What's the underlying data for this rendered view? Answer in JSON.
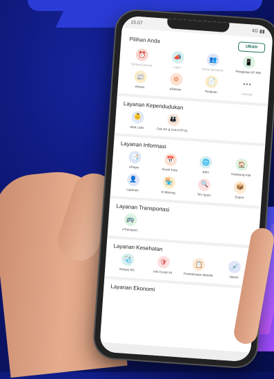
{
  "status": {
    "time": "15.07",
    "right": "4G ▮▮"
  },
  "header": {
    "title": "Pilihan Anda",
    "button": "UBAH"
  },
  "pilihan": [
    {
      "label": "Tombol Darurat",
      "icon": "alarm-icon",
      "color": "#f8d7d0",
      "fg": "#d9534f",
      "muted": true
    },
    {
      "label": "Lapor",
      "icon": "megaphone-icon",
      "color": "#d6eef0",
      "fg": "#0e8a8a",
      "muted": true
    },
    {
      "label": "Aman Bersama",
      "icon": "people-icon",
      "color": "#dde3f7",
      "fg": "#3a57c4",
      "muted": true
    },
    {
      "label": "Pengantar RT RW",
      "icon": "phone-doc-icon",
      "color": "#d9f2e1",
      "fg": "#21955a",
      "muted": false
    },
    {
      "label": "eNews",
      "icon": "news-icon",
      "color": "#fbecc8",
      "fg": "#d99a14",
      "muted": false
    },
    {
      "label": "eRetrive",
      "icon": "gear-icon",
      "color": "#fde0d0",
      "fg": "#e06a2d",
      "muted": false
    },
    {
      "label": "Perijinan",
      "icon": "document-icon",
      "color": "#fbecc8",
      "fg": "#c98a14",
      "muted": false
    },
    {
      "label": "Lainnya",
      "icon": "more-icon",
      "color": "#ffffff",
      "fg": "#777777",
      "muted": true
    }
  ],
  "sections": [
    {
      "title": "Layanan Kependudukan",
      "items": [
        {
          "label": "Akta Lahir",
          "icon": "baby-icon",
          "color": "#dfe9f7",
          "fg": "#3a6fc4"
        },
        {
          "label": "Cek KK & Cek KTP-EL",
          "icon": "family-icon",
          "color": "#fde6d6",
          "fg": "#e07b39"
        }
      ]
    },
    {
      "title": "Layanan Informasi",
      "items": [
        {
          "label": "ePaper",
          "icon": "paper-icon",
          "color": "#dfe6f7",
          "fg": "#3a57c4"
        },
        {
          "label": "Event Kota",
          "icon": "calendar-icon",
          "color": "#fde0d0",
          "fg": "#d9534f"
        },
        {
          "label": "JDIH",
          "icon": "globe-icon",
          "color": "#d6eef0",
          "fg": "#1c8d8d"
        },
        {
          "label": "Kampung Kita",
          "icon": "house-icon",
          "color": "#dff3e3",
          "fg": "#2e9a56"
        },
        {
          "label": "Layanan",
          "icon": "user-icon",
          "color": "#dfe6f7",
          "fg": "#2b4fa8"
        },
        {
          "label": "E-Warung",
          "icon": "shop-icon",
          "color": "#fbecc8",
          "fg": "#cf8a10"
        },
        {
          "label": "Tim Sport",
          "icon": "search-icon",
          "color": "#fde0e0",
          "fg": "#d04a4a"
        },
        {
          "label": "Export",
          "icon": "export-icon",
          "color": "#fde8d2",
          "fg": "#e07a2a"
        }
      ]
    },
    {
      "title": "Layanan Transportasi",
      "items": [
        {
          "label": "eTransport",
          "icon": "bus-icon",
          "color": "#d9f2e1",
          "fg": "#21955a"
        }
      ]
    },
    {
      "title": "Layanan Kesehatan",
      "items": [
        {
          "label": "Rekam RS",
          "icon": "health-icon",
          "color": "#d6eef0",
          "fg": "#1c8d8d"
        },
        {
          "label": "Info Covid-19",
          "icon": "shield-icon",
          "color": "#fde0e0",
          "fg": "#d04a4a"
        },
        {
          "label": "Pemeriksaan Mandiri",
          "icon": "checkup-icon",
          "color": "#fde8d2",
          "fg": "#e07a2a"
        },
        {
          "label": "Vaksin",
          "icon": "vaccine-icon",
          "color": "#dfe6f7",
          "fg": "#3a57c4"
        }
      ]
    },
    {
      "title": "Layanan Ekonomi",
      "items": []
    }
  ],
  "glyphs": {
    "alarm-icon": "⏰",
    "megaphone-icon": "📣",
    "people-icon": "👥",
    "phone-doc-icon": "📱",
    "news-icon": "📰",
    "gear-icon": "⚙",
    "document-icon": "📄",
    "more-icon": "•••",
    "baby-icon": "👶",
    "family-icon": "👪",
    "paper-icon": "📑",
    "calendar-icon": "📅",
    "globe-icon": "🌐",
    "house-icon": "🏠",
    "user-icon": "👤",
    "shop-icon": "🏪",
    "search-icon": "🔍",
    "export-icon": "📦",
    "bus-icon": "🚌",
    "health-icon": "🩺",
    "shield-icon": "🛡",
    "checkup-icon": "📋",
    "vaccine-icon": "💉"
  }
}
